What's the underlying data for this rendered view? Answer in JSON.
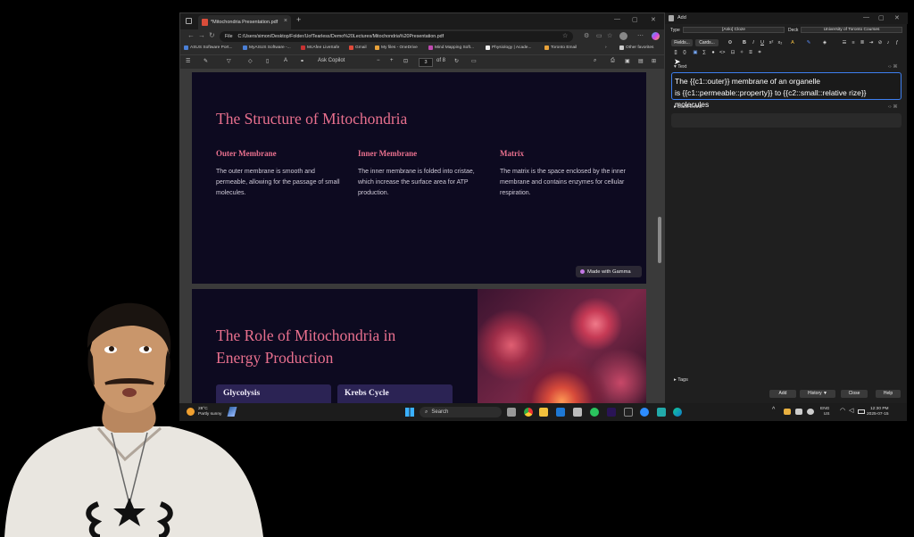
{
  "browser": {
    "tab_title": "*Mitochondria Presentation.pdf",
    "new_tab": "+",
    "url_prefix": "File",
    "url": "C:/Users/simon/Desktop/Folder/UofTearless/Demo%20Lectures/Mitochondria%20Presentation.pdf",
    "bookmarks": [
      {
        "label": "ASUS Software Port...",
        "color": "#4a7fd6"
      },
      {
        "label": "MyASUS Software -...",
        "color": "#4a7fd6"
      },
      {
        "label": "McAfee LiveSafe",
        "color": "#c83232"
      },
      {
        "label": "Gmail",
        "color": "#e04a3a"
      },
      {
        "label": "My files - OneDrive",
        "color": "#e8a23a"
      },
      {
        "label": "Mind Mapping Soft...",
        "color": "#c04ab0"
      },
      {
        "label": "Physiology | Acade...",
        "color": "#eeeeee"
      },
      {
        "label": "Toronto Email",
        "color": "#e8a23a"
      }
    ],
    "other_favorites": "Other favorites",
    "pdf_toolbar": {
      "ask_copilot": "Ask Copilot",
      "zoom_out": "−",
      "zoom_in": "+",
      "page_current": "3",
      "page_total": "of 8"
    }
  },
  "slides": {
    "slide1": {
      "title": "The Structure of Mitochondria",
      "columns": [
        {
          "heading": "Outer Membrane",
          "body": "The outer membrane is smooth and permeable, allowing for the passage of small molecules."
        },
        {
          "heading": "Inner Membrane",
          "body": "The inner membrane is folded into cristae, which increase the surface area for ATP production."
        },
        {
          "heading": "Matrix",
          "body": "The matrix is the space enclosed by the inner membrane and contains enzymes for cellular respiration."
        }
      ],
      "badge": "Made with Gamma"
    },
    "slide2": {
      "title_line1": "The Role of Mitochondria in",
      "title_line2": "Energy Production",
      "cards": [
        "Glycolysis",
        "Krebs Cycle"
      ]
    }
  },
  "taskbar": {
    "weather_temp": "28°C",
    "weather_desc": "Partly sunny",
    "search_placeholder": "Search",
    "lang": "ENG",
    "region": "US",
    "time": "12:30 PM",
    "date": "2025-07-15"
  },
  "anki": {
    "window_title": "Add",
    "type_label": "Type",
    "type_value": "[Ankı] Cloze",
    "deck_label": "Deck",
    "deck_value": "University of Toronto Courses",
    "fields_btn": "Fields...",
    "cards_btn": "Cards...",
    "text_label": "Text",
    "text_line1": "The {{c1::outer}} membrane of an organelle",
    "text_line2": "is {{c1::permeable::property}} to {{c2::small::relative rize}} molecules",
    "back_extra_label": "Back Extra",
    "tags_label": "Tags",
    "buttons": {
      "add": "Add",
      "history": "History ▼",
      "close": "Close",
      "help": "Help"
    }
  },
  "colors": {
    "slide_bg": "#0d0a20",
    "slide_title": "#e9708e",
    "card_bg": "#2b2354",
    "focus_border": "#3d7ff0"
  }
}
